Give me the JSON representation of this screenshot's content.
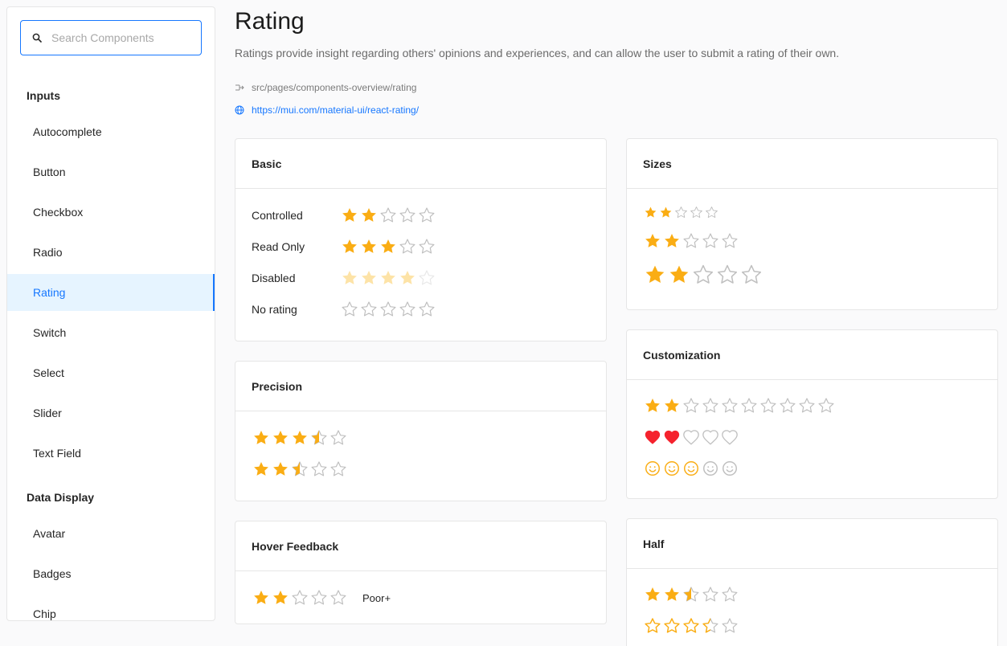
{
  "search": {
    "placeholder": "Search Components"
  },
  "sidebar": {
    "groups": [
      "Inputs",
      "Data Display"
    ],
    "items": [
      "Autocomplete",
      "Button",
      "Checkbox",
      "Radio",
      "Rating",
      "Switch",
      "Select",
      "Slider",
      "Text Field",
      "Avatar",
      "Badges",
      "Chip"
    ],
    "active": "Rating"
  },
  "page": {
    "title": "Rating",
    "description": "Ratings provide insight regarding others' opinions and experiences, and can allow the user to submit a rating of their own.",
    "path": "src/pages/components-overview/rating",
    "link": "https://mui.com/material-ui/react-rating/"
  },
  "colors": {
    "star_filled": "#faad14",
    "star_disabled": "#fde3a7",
    "star_empty": "#bfbfbf",
    "heart": "#f5222d",
    "accent": "#1677ff"
  },
  "cards": {
    "basic": {
      "title": "Basic",
      "rows": [
        {
          "label": "Controlled",
          "value": 2,
          "max": 5
        },
        {
          "label": "Read Only",
          "value": 3,
          "max": 5
        },
        {
          "label": "Disabled",
          "value": 4,
          "max": 5
        },
        {
          "label": "No rating",
          "value": 0,
          "max": 5
        }
      ]
    },
    "precision": {
      "title": "Precision",
      "rows": [
        {
          "value": 3.5,
          "max": 5
        },
        {
          "value": 2.5,
          "max": 5
        }
      ]
    },
    "hover": {
      "title": "Hover Feedback",
      "value": 2,
      "max": 5,
      "label": "Poor+"
    },
    "sizes": {
      "title": "Sizes",
      "rows": [
        {
          "size": "small",
          "value": 2,
          "max": 5
        },
        {
          "size": "medium",
          "value": 2,
          "max": 5
        },
        {
          "size": "large",
          "value": 2,
          "max": 5
        }
      ]
    },
    "customization": {
      "title": "Customization",
      "rows": [
        {
          "icon": "star",
          "value": 2,
          "max": 10
        },
        {
          "icon": "heart",
          "value": 2,
          "max": 5
        },
        {
          "icon": "smiley",
          "value": 3,
          "max": 5
        }
      ]
    },
    "half": {
      "title": "Half",
      "rows": [
        {
          "value": 2.5,
          "max": 5,
          "style": "filled"
        },
        {
          "value": 3.5,
          "max": 5,
          "style": "outline"
        }
      ]
    }
  }
}
